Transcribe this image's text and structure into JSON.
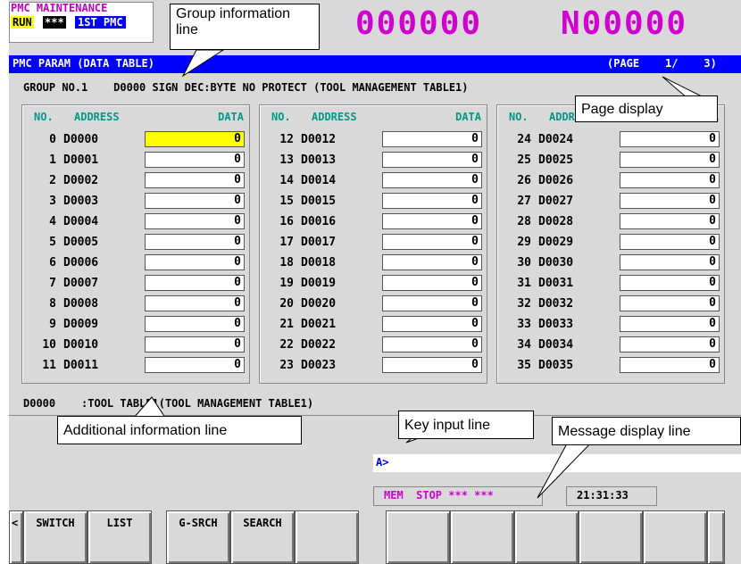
{
  "header": {
    "mode_title": "PMC MAINTENANCE",
    "run": "RUN",
    "stars": "***",
    "pmc": "1ST PMC",
    "o_number": "000000",
    "n_number": "N00000"
  },
  "title_bar": {
    "title": "PMC PARAM (DATA TABLE)",
    "page": "(PAGE    1/    3)"
  },
  "group_line": "GROUP NO.1    D0000 SIGN DEC:BYTE NO PROTECT (TOOL MANAGEMENT TABLE1)",
  "columns": {
    "head_no": "NO.",
    "head_address": "ADDRESS",
    "head_data": "DATA"
  },
  "rows": [
    {
      "no": "0",
      "addr": "D0000",
      "data": "0"
    },
    {
      "no": "1",
      "addr": "D0001",
      "data": "0"
    },
    {
      "no": "2",
      "addr": "D0002",
      "data": "0"
    },
    {
      "no": "3",
      "addr": "D0003",
      "data": "0"
    },
    {
      "no": "4",
      "addr": "D0004",
      "data": "0"
    },
    {
      "no": "5",
      "addr": "D0005",
      "data": "0"
    },
    {
      "no": "6",
      "addr": "D0006",
      "data": "0"
    },
    {
      "no": "7",
      "addr": "D0007",
      "data": "0"
    },
    {
      "no": "8",
      "addr": "D0008",
      "data": "0"
    },
    {
      "no": "9",
      "addr": "D0009",
      "data": "0"
    },
    {
      "no": "10",
      "addr": "D0010",
      "data": "0"
    },
    {
      "no": "11",
      "addr": "D0011",
      "data": "0"
    },
    {
      "no": "12",
      "addr": "D0012",
      "data": "0"
    },
    {
      "no": "13",
      "addr": "D0013",
      "data": "0"
    },
    {
      "no": "14",
      "addr": "D0014",
      "data": "0"
    },
    {
      "no": "15",
      "addr": "D0015",
      "data": "0"
    },
    {
      "no": "16",
      "addr": "D0016",
      "data": "0"
    },
    {
      "no": "17",
      "addr": "D0017",
      "data": "0"
    },
    {
      "no": "18",
      "addr": "D0018",
      "data": "0"
    },
    {
      "no": "19",
      "addr": "D0019",
      "data": "0"
    },
    {
      "no": "20",
      "addr": "D0020",
      "data": "0"
    },
    {
      "no": "21",
      "addr": "D0021",
      "data": "0"
    },
    {
      "no": "22",
      "addr": "D0022",
      "data": "0"
    },
    {
      "no": "23",
      "addr": "D0023",
      "data": "0"
    },
    {
      "no": "24",
      "addr": "D0024",
      "data": "0"
    },
    {
      "no": "25",
      "addr": "D0025",
      "data": "0"
    },
    {
      "no": "26",
      "addr": "D0026",
      "data": "0"
    },
    {
      "no": "27",
      "addr": "D0027",
      "data": "0"
    },
    {
      "no": "28",
      "addr": "D0028",
      "data": "0"
    },
    {
      "no": "29",
      "addr": "D0029",
      "data": "0"
    },
    {
      "no": "30",
      "addr": "D0030",
      "data": "0"
    },
    {
      "no": "31",
      "addr": "D0031",
      "data": "0"
    },
    {
      "no": "32",
      "addr": "D0032",
      "data": "0"
    },
    {
      "no": "33",
      "addr": "D0033",
      "data": "0"
    },
    {
      "no": "34",
      "addr": "D0034",
      "data": "0"
    },
    {
      "no": "35",
      "addr": "D0035",
      "data": "0"
    }
  ],
  "additional_info": "D0000    :TOOL TABLE1(TOOL MANAGEMENT TABLE1)",
  "key_input": {
    "prompt": "A>"
  },
  "status": {
    "mem": "MEM  STOP *** ***",
    "time": "21:31:33"
  },
  "softkeys": {
    "left_arrow": "<",
    "switch": "SWITCH",
    "list": "LIST",
    "gsrch": "G-SRCH",
    "search": "SEARCH"
  },
  "callouts": {
    "group": "Group information line",
    "page": "Page display",
    "additional": "Additional information line",
    "key": "Key input line",
    "message": "Message display line"
  }
}
